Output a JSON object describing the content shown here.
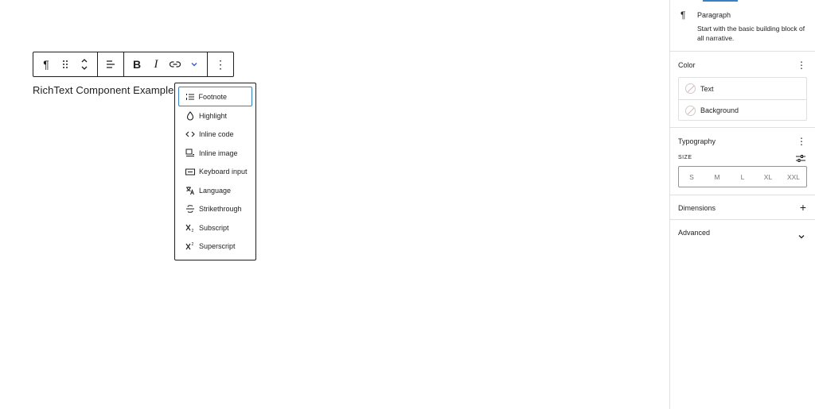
{
  "editor": {
    "paragraph_text": "RichText Component Example"
  },
  "toolbar": {
    "paragraph_glyph": "¶",
    "bold_label": "B",
    "italic_label": "I",
    "more_glyph": "⋮"
  },
  "format_menu": {
    "items": [
      {
        "label": "Footnote",
        "icon": "footnote-icon"
      },
      {
        "label": "Highlight",
        "icon": "droplet-icon"
      },
      {
        "label": "Inline code",
        "icon": "code-icon"
      },
      {
        "label": "Inline image",
        "icon": "image-icon"
      },
      {
        "label": "Keyboard input",
        "icon": "keyboard-icon"
      },
      {
        "label": "Language",
        "icon": "translate-icon"
      },
      {
        "label": "Strikethrough",
        "icon": "strikethrough-icon"
      },
      {
        "label": "Subscript",
        "icon": "subscript-icon"
      },
      {
        "label": "Superscript",
        "icon": "superscript-icon"
      }
    ],
    "focused_item": "Footnote"
  },
  "sidebar": {
    "block": {
      "icon": "¶",
      "title": "Paragraph",
      "description": "Start with the basic building block of all narrative."
    },
    "color": {
      "title": "Color",
      "options": [
        "Text",
        "Background"
      ]
    },
    "typography": {
      "title": "Typography",
      "size_label": "SIZE",
      "sizes": [
        "S",
        "M",
        "L",
        "XL",
        "XXL"
      ]
    },
    "dimensions": {
      "title": "Dimensions",
      "action": "+"
    },
    "advanced": {
      "title": "Advanced"
    },
    "panel_menu_glyph": "⋮"
  },
  "colors": {
    "border_dark": "#1e1e1e",
    "divider": "#e0e0e0",
    "focus_blue": "#3582c4",
    "accent": "#3858e9"
  }
}
